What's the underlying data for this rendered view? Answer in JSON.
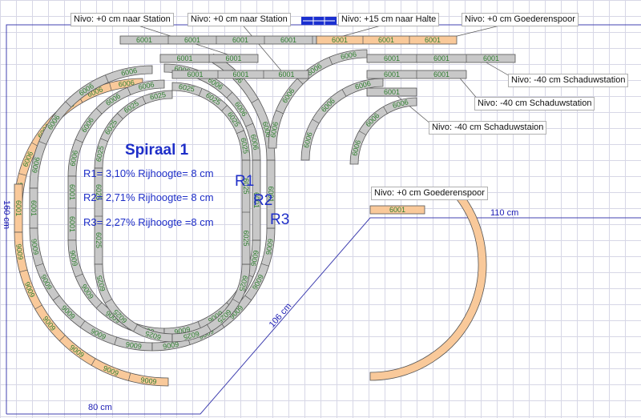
{
  "title": "Spiraal 1",
  "grades": [
    "R1= 3,10% Rijhoogte= 8 cm",
    "R2= 2,71% Rijhoogte= 8 cm",
    "R3= 2,27% Rijhoogte =8 cm"
  ],
  "radius_marks": [
    "R1",
    "R2",
    "R3"
  ],
  "level_labels": {
    "station_left": "Nivo: +0 cm naar Station",
    "station_right": "Nivo: +0 cm naar Station",
    "halte": "Nivo: +15 cm naar Halte",
    "goederen_top": "Nivo: +0 cm Goederenspoor",
    "schaduw_1": "Nivo: -40 cm Schaduwstation",
    "schaduw_2": "Nivo: -40 cm Schaduwstation",
    "schaduw_3": "Nivo: -40 cm Schaduwstaion",
    "goederen_mid": "Nivo: +0 cm Goederenspoor"
  },
  "dimensions": {
    "height": "160 cm",
    "bottom": "80 cm",
    "diagonal": "106 cm",
    "right": "110 cm"
  },
  "track_codes": {
    "straight": "6001",
    "curve_large": "6006",
    "curve_small": "6025"
  },
  "colors": {
    "track_gray": "#c8c8c8",
    "track_orange": "#f9c99a",
    "outline": "#4040b0",
    "text_blue": "#1e2ec8",
    "label_green": "#2e7d2e"
  }
}
